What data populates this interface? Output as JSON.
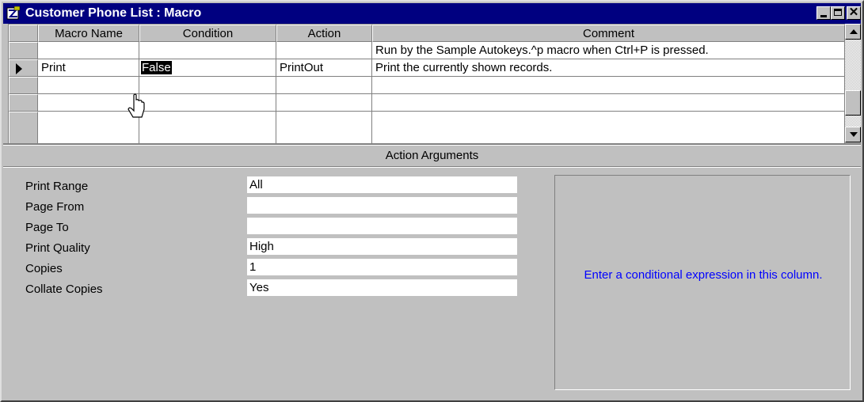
{
  "window": {
    "title": "Customer Phone List : Macro"
  },
  "grid": {
    "columns": [
      "Macro Name",
      "Condition",
      "Action",
      "Comment"
    ],
    "rows": [
      {
        "macro_name": "",
        "condition": "",
        "action": "",
        "comment": "Run by the Sample Autokeys.^p macro when Ctrl+P is pressed."
      },
      {
        "macro_name": "Print",
        "condition": "False",
        "action": "PrintOut",
        "comment": "Print the currently shown records."
      },
      {
        "macro_name": "",
        "condition": "",
        "action": "",
        "comment": ""
      },
      {
        "macro_name": "",
        "condition": "",
        "action": "",
        "comment": ""
      }
    ],
    "current_row_index": 1,
    "selected_cell": "condition"
  },
  "action_arguments": {
    "title": "Action Arguments",
    "items": [
      {
        "label": "Print Range",
        "value": "All"
      },
      {
        "label": "Page From",
        "value": ""
      },
      {
        "label": "Page To",
        "value": ""
      },
      {
        "label": "Print Quality",
        "value": "High"
      },
      {
        "label": "Copies",
        "value": "1"
      },
      {
        "label": "Collate Copies",
        "value": "Yes"
      }
    ]
  },
  "help": {
    "text": "Enter a conditional expression in this column."
  },
  "icons": {
    "window_icon": "macro-icon",
    "minimize": "minimize-icon",
    "maximize": "maximize-icon",
    "close": "close-icon",
    "row_selector": "current-record-arrow-icon",
    "cursor": "pointer-cursor-icon"
  },
  "colors": {
    "titlebar": "#000080",
    "help_text": "#0000ff",
    "face": "#c0c0c0"
  }
}
